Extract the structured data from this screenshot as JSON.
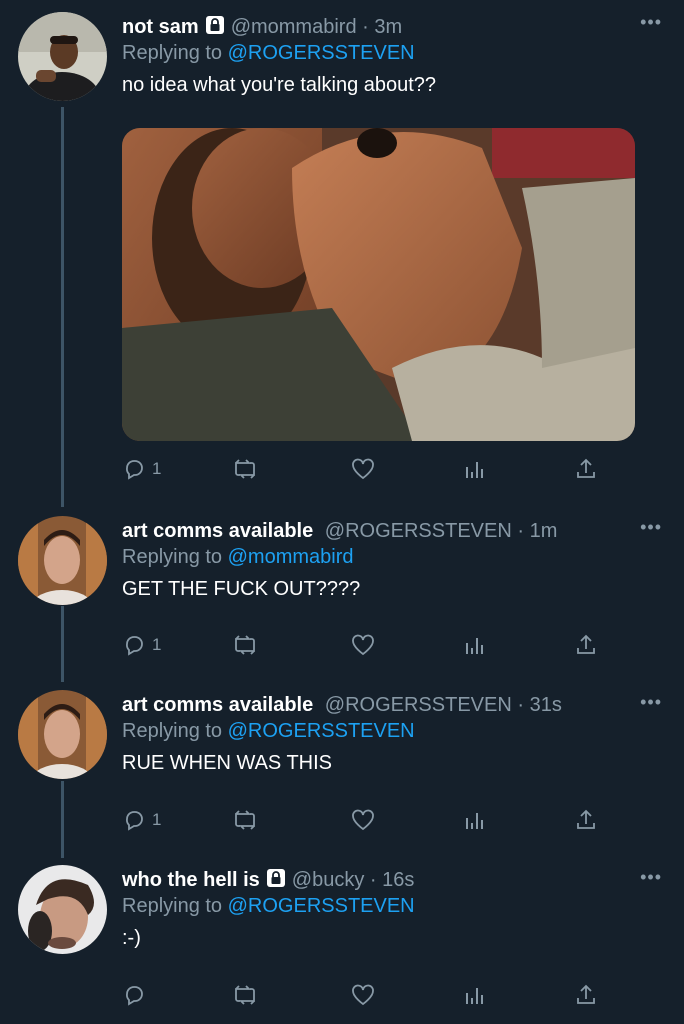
{
  "tweets": [
    {
      "name": "not sam",
      "locked": true,
      "handle": "@mommabird",
      "separator": "·",
      "time": "3m",
      "replying_prefix": "Replying to",
      "replying_to": "@ROGERSSTEVEN",
      "text": "no idea what you're talking about??",
      "has_media": true,
      "reply_count": "1"
    },
    {
      "name": "art comms available",
      "locked": false,
      "handle": "@ROGERSSTEVEN",
      "separator": "·",
      "time": "1m",
      "replying_prefix": "Replying to",
      "replying_to": "@mommabird",
      "text": "GET THE FUCK OUT????",
      "reply_count": "1"
    },
    {
      "name": "art comms available",
      "locked": false,
      "handle": "@ROGERSSTEVEN",
      "separator": "·",
      "time": "31s",
      "replying_prefix": "Replying to",
      "replying_to": "@ROGERSSTEVEN",
      "text": "RUE WHEN WAS THIS",
      "reply_count": "1"
    },
    {
      "name": "who the hell is",
      "locked": true,
      "handle": "@bucky",
      "separator": "·",
      "time": "16s",
      "replying_prefix": "Replying to",
      "replying_to": "@ROGERSSTEVEN",
      "text": ":-)",
      "reply_count": ""
    }
  ],
  "icons": {
    "more": "more-options-icon",
    "reply": "reply-icon",
    "retweet": "retweet-icon",
    "like": "heart-icon",
    "analytics": "analytics-icon",
    "share": "share-icon",
    "lock": "lock-icon"
  },
  "colors": {
    "background": "#15202b",
    "secondary_text": "#8899a6",
    "accent": "#1da1f2",
    "thread_line": "#3d5466"
  }
}
